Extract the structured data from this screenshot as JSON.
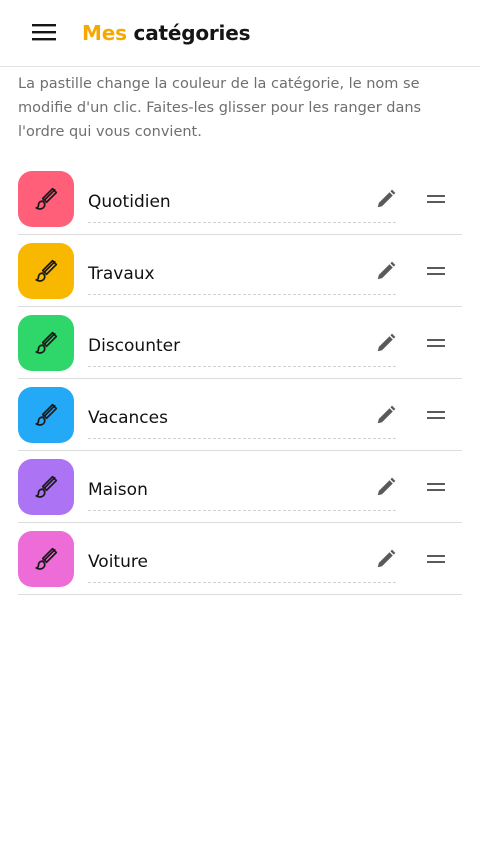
{
  "header": {
    "title_accent": "Mes",
    "title_main": "catégories",
    "accent_color": "#f7a800",
    "menu_icon": "hamburger-menu-icon"
  },
  "intro": {
    "text": "La pastille change la couleur de la catégorie, le nom se modifie d'un clic. Faites-les glisser pour les ranger dans l'ordre qui vous convient."
  },
  "categories": [
    {
      "name": "Quotidien",
      "color": "#ff5f78",
      "icon": "paintbrush-icon"
    },
    {
      "name": "Travaux",
      "color": "#f8b800",
      "icon": "paintbrush-icon"
    },
    {
      "name": "Discounter",
      "color": "#2fd66a",
      "icon": "paintbrush-icon"
    },
    {
      "name": "Vacances",
      "color": "#23a9f5",
      "icon": "paintbrush-icon"
    },
    {
      "name": "Maison",
      "color": "#ad73f5",
      "icon": "paintbrush-icon"
    },
    {
      "name": "Voiture",
      "color": "#ee6cd8",
      "icon": "paintbrush-icon"
    }
  ],
  "row_icons": {
    "edit": "pencil-icon",
    "drag": "drag-handle-icon"
  }
}
